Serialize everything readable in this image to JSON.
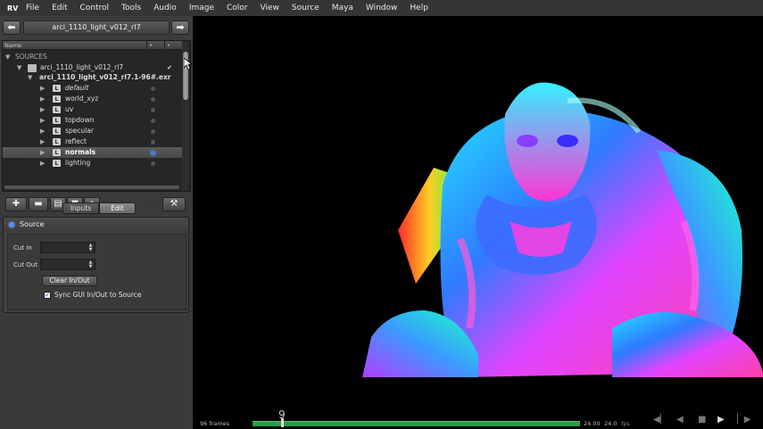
{
  "app": {
    "logo": "RV"
  },
  "menubar": {
    "items": [
      "File",
      "Edit",
      "Control",
      "Tools",
      "Audio",
      "Image",
      "Color",
      "View",
      "Source",
      "Maya",
      "Window",
      "Help"
    ]
  },
  "session": {
    "title": "arci_1110_light_v012_rl7"
  },
  "tree": {
    "header": {
      "name_col": "Name",
      "col2": "•",
      "col3": "•"
    },
    "sources_label": "SOURCES",
    "source_node": "arci_1110_light_v012_rl7",
    "file_node": "arci_1110_light_v012_rl7.1-96#.exr",
    "layers": [
      {
        "label": "default",
        "italic": true
      },
      {
        "label": "world_xyz"
      },
      {
        "label": "uv"
      },
      {
        "label": "topdown"
      },
      {
        "label": "specular"
      },
      {
        "label": "reflect"
      },
      {
        "label": "normals",
        "selected": true
      },
      {
        "label": "lighting"
      }
    ],
    "layer_icon": "L",
    "checkmark": "✔"
  },
  "toolbar": {
    "icons": [
      "add-icon",
      "folder-icon",
      "trash-icon",
      "comment-icon",
      "home-icon",
      "wrench-icon"
    ]
  },
  "tabs": {
    "inputs": "Inputs",
    "edit": "Edit"
  },
  "source_panel": {
    "title": "Source",
    "cut_in_label": "Cut In",
    "cut_out_label": "Cut Out",
    "clear_button": "Clear In/Out",
    "sync_label": "Sync GUI In/Out to Source",
    "sync_checked": true
  },
  "timeline": {
    "frames_label": "96 frames",
    "current_frame": "9",
    "fps_value": "24.00",
    "fps_target": "24.0",
    "fps_unit": "fps",
    "progress": 0.09
  },
  "colors": {
    "accent": "#3a7fe0",
    "timeline_green": "#2c9a4a"
  }
}
